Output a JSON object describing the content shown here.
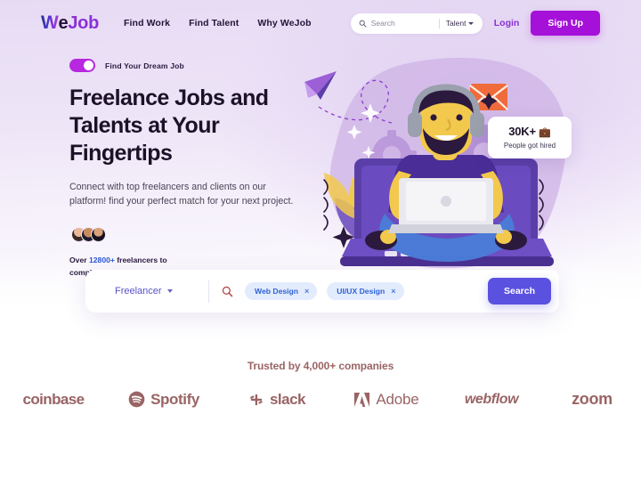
{
  "brand": {
    "logo_w": "W",
    "logo_e": "e",
    "logo_job": "Job"
  },
  "header": {
    "nav": [
      {
        "label": "Find Work"
      },
      {
        "label": "Find Talent"
      },
      {
        "label": "Why WeJob"
      }
    ],
    "search": {
      "placeholder": "Search",
      "value": "",
      "scope": "Talent"
    },
    "login_label": "Login",
    "signup_label": "Sign Up"
  },
  "hero": {
    "eyebrow": "Find Your Dream Job",
    "toggle_on": true,
    "headline": "Freelance Jobs and Talents at Your Fingertips",
    "subtext": "Connect with top freelancers and clients on our platform! find your perfect match for your next project.",
    "stat_prefix": "Over",
    "stat_number": "12800+",
    "stat_suffix": "freelancers to",
    "stat_line2": "complete your projects",
    "hired_badge": {
      "count": "30K+",
      "icon": "briefcase-icon",
      "caption": "People got hired"
    }
  },
  "search_card": {
    "category": "Freelancer",
    "search_icon": "magnifier-icon",
    "tags": [
      {
        "label": "Web Design",
        "remove": "×"
      },
      {
        "label": "UI/UX Design",
        "remove": "×"
      }
    ],
    "button_label": "Search"
  },
  "trusted": {
    "title": "Trusted by 4,000+ companies",
    "brands": [
      {
        "name": "coinbase"
      },
      {
        "name": "Spotify"
      },
      {
        "name": "slack"
      },
      {
        "name": "Adobe"
      },
      {
        "name": "webflow"
      },
      {
        "name": "zoom"
      }
    ]
  },
  "colors": {
    "primary_purple": "#a511d8",
    "indigo": "#5b51e0",
    "tag_blue": "#2f62d8",
    "tag_bg": "#e3ecfd",
    "stat_blue": "#2c57d6",
    "muted_brand": "#9a6464",
    "hero_bg_top": "#e7dbf4"
  }
}
